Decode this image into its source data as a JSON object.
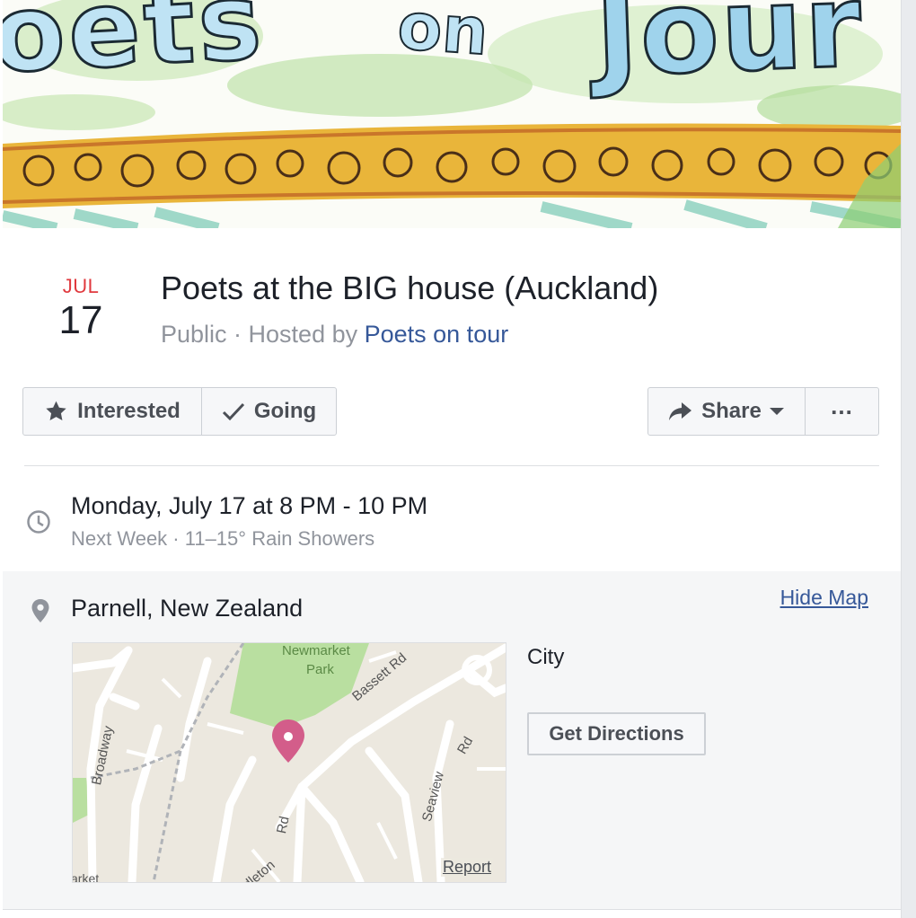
{
  "cover": {
    "text_left": "oets",
    "text_mid": "on",
    "text_right": "Jour"
  },
  "event": {
    "month": "JUL",
    "day": "17",
    "title": "Poets at the BIG house (Auckland)",
    "privacy": "Public",
    "separator": " · Hosted by ",
    "host": "Poets on tour"
  },
  "actions": {
    "interested": "Interested",
    "going": "Going",
    "share": "Share",
    "more": "..."
  },
  "time": {
    "main": "Monday, July 17 at 8 PM - 10 PM",
    "sub": "Next Week · 11–15° Rain Showers"
  },
  "location": {
    "name": "Parnell, New Zealand",
    "hide_map": "Hide Map",
    "city": "City",
    "directions": "Get Directions"
  },
  "map": {
    "park": "Newmarket",
    "park2": "Park",
    "road_bassett": "Bassett Rd",
    "road_broadway": "Broadway",
    "road_seaview": "Seaview",
    "road_rd": "Rd",
    "road_middleton": "ddleton",
    "road_middleton_rd": "Rd",
    "market": "arket",
    "report": "Report"
  },
  "colors": {
    "accent": "#e0393e",
    "link": "#365899",
    "pin": "#d35d8a"
  }
}
